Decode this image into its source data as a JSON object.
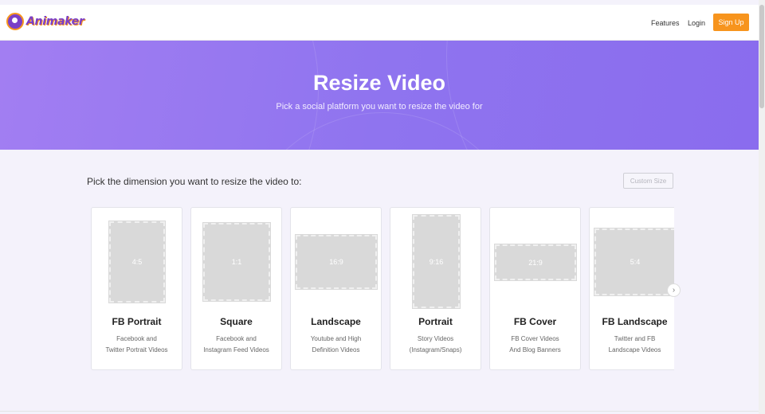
{
  "header": {
    "logo_text": "Animaker",
    "nav": {
      "features": "Features",
      "login": "Login"
    },
    "signup": "Sign Up",
    "accent": "#f7941d",
    "brand": "#7b3fc7"
  },
  "hero": {
    "title": "Resize Video",
    "subtitle": "Pick a social platform you want to resize the video for",
    "gradient": [
      "#a27ef2",
      "#8a6cee"
    ]
  },
  "main": {
    "pick_label": "Pick the dimension you want to resize the video to:",
    "custom_size": "Custom Size",
    "next_icon": "chevron-right-icon",
    "cards": [
      {
        "ratio": "4:5",
        "title": "FB Portrait",
        "desc1": "Facebook and",
        "desc2": "Twitter Portrait Videos"
      },
      {
        "ratio": "1:1",
        "title": "Square",
        "desc1": "Facebook and",
        "desc2": "Instagram Feed Videos"
      },
      {
        "ratio": "16:9",
        "title": "Landscape",
        "desc1": "Youtube and High",
        "desc2": "Definition Videos"
      },
      {
        "ratio": "9:16",
        "title": "Portrait",
        "desc1": "Story Videos",
        "desc2": "(Instagram/Snaps)"
      },
      {
        "ratio": "21:9",
        "title": "FB Cover",
        "desc1": "FB Cover Videos",
        "desc2": "And Blog Banners"
      },
      {
        "ratio": "5:4",
        "title": "FB Landscape",
        "desc1": "Twitter and FB",
        "desc2": "Landscape Videos"
      }
    ]
  }
}
